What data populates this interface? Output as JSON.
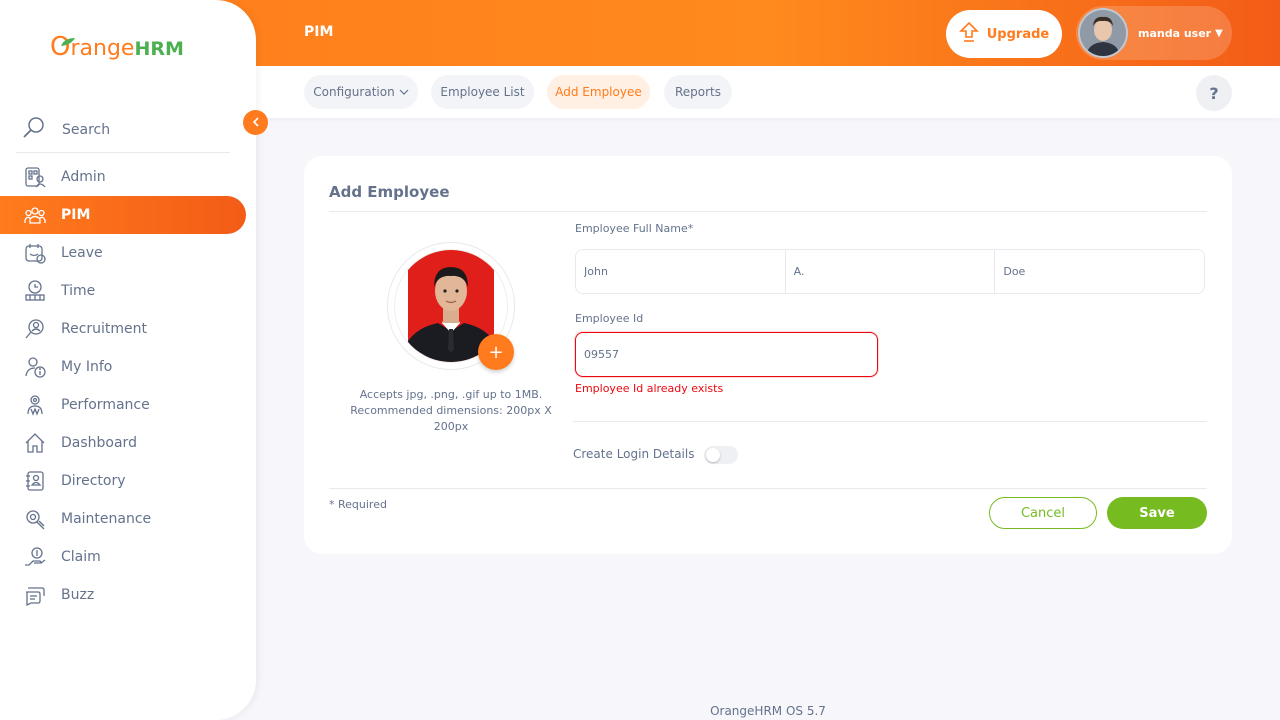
{
  "app": {
    "logo_first": "O",
    "logo_rest": "range",
    "logo_hrm": "HRM",
    "module_title": "PIM",
    "footer": "OrangeHRM OS 5.7"
  },
  "header": {
    "upgrade_label": "Upgrade",
    "user_name": "manda user"
  },
  "subnav": {
    "tabs": [
      {
        "label": "Configuration",
        "has_dropdown": true
      },
      {
        "label": "Employee List"
      },
      {
        "label": "Add Employee",
        "active": true
      },
      {
        "label": "Reports"
      }
    ],
    "help_label": "?"
  },
  "sidebar": {
    "search_label": "Search",
    "items": [
      {
        "label": "Admin",
        "icon": "admin-icon"
      },
      {
        "label": "PIM",
        "icon": "pim-icon",
        "active": true
      },
      {
        "label": "Leave",
        "icon": "leave-icon"
      },
      {
        "label": "Time",
        "icon": "time-icon"
      },
      {
        "label": "Recruitment",
        "icon": "recruitment-icon"
      },
      {
        "label": "My Info",
        "icon": "my-info-icon"
      },
      {
        "label": "Performance",
        "icon": "performance-icon"
      },
      {
        "label": "Dashboard",
        "icon": "dashboard-icon"
      },
      {
        "label": "Directory",
        "icon": "directory-icon"
      },
      {
        "label": "Maintenance",
        "icon": "maintenance-icon"
      },
      {
        "label": "Claim",
        "icon": "claim-icon"
      },
      {
        "label": "Buzz",
        "icon": "buzz-icon"
      }
    ]
  },
  "form": {
    "title": "Add Employee",
    "photo_hint": "Accepts jpg, .png, .gif up to 1MB. Recommended dimensions: 200px X 200px",
    "full_name_label": "Employee Full Name*",
    "first_name": "John",
    "middle_name": "A.",
    "last_name": "Doe",
    "employee_id_label": "Employee Id",
    "employee_id": "09557",
    "employee_id_error": "Employee Id already exists",
    "create_login_label": "Create Login Details",
    "create_login_enabled": false,
    "required_note": "* Required",
    "cancel_label": "Cancel",
    "save_label": "Save",
    "add_photo_label": "+"
  },
  "colors": {
    "brand_orange": "#ff7b1d",
    "accent_green": "#76bc21",
    "error_red": "#eb0910"
  }
}
